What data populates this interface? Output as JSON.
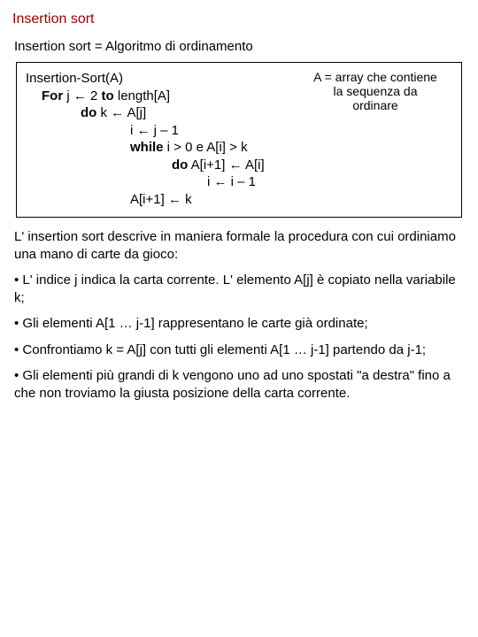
{
  "title": "Insertion sort",
  "subtitle": "Insertion sort = Algoritmo di ordinamento",
  "algo": {
    "l1": "Insertion-Sort(A)",
    "l2a": "For",
    "l2b": " j ← 2 ",
    "l2c": "to",
    "l2d": " length[A]",
    "l3a": "do",
    "l3b": "      k ← A[j]",
    "l4": "i ← j – 1",
    "l5a": "while",
    "l5b": " i > 0 e A[i] > k",
    "l6a": "do",
    "l6b": "    A[i+1] ← A[i]",
    "l7": "i ← i – 1",
    "l8": "A[i+1] ← k",
    "note_l1": "A = array che contiene",
    "note_l2": "la sequenza da",
    "note_l3": "ordinare"
  },
  "para1": "L' insertion sort descrive in maniera formale la procedura con cui ordiniamo una mano di carte da gioco:",
  "bullet1": "• L' indice j indica la carta corrente. L' elemento A[j] è copiato nella variabile k;",
  "bullet2": "• Gli elementi A[1 … j-1] rappresentano le carte già ordinate;",
  "bullet3": "• Confrontiamo k = A[j] con tutti gli elementi A[1 … j-1] partendo da j-1;",
  "bullet4": "• Gli elementi più grandi di k  vengono uno ad uno spostati \"a destra\" fino a che non troviamo la giusta posizione della carta corrente."
}
